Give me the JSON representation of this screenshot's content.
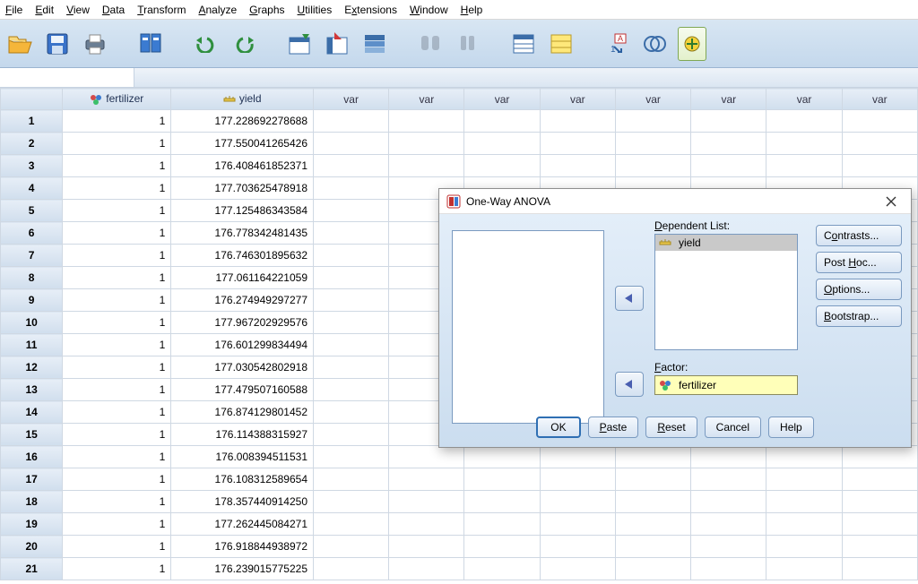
{
  "menu": [
    "File",
    "Edit",
    "View",
    "Data",
    "Transform",
    "Analyze",
    "Graphs",
    "Utilities",
    "Extensions",
    "Window",
    "Help"
  ],
  "columns": {
    "var1": "fertilizer",
    "var2": "yield",
    "blank": "var"
  },
  "rows": [
    {
      "n": "1",
      "f": "1",
      "y": "177.228692278688"
    },
    {
      "n": "2",
      "f": "1",
      "y": "177.550041265426"
    },
    {
      "n": "3",
      "f": "1",
      "y": "176.408461852371"
    },
    {
      "n": "4",
      "f": "1",
      "y": "177.703625478918"
    },
    {
      "n": "5",
      "f": "1",
      "y": "177.125486343584"
    },
    {
      "n": "6",
      "f": "1",
      "y": "176.778342481435"
    },
    {
      "n": "7",
      "f": "1",
      "y": "176.746301895632"
    },
    {
      "n": "8",
      "f": "1",
      "y": "177.061164221059"
    },
    {
      "n": "9",
      "f": "1",
      "y": "176.274949297277"
    },
    {
      "n": "10",
      "f": "1",
      "y": "177.967202929576"
    },
    {
      "n": "11",
      "f": "1",
      "y": "176.601299834494"
    },
    {
      "n": "12",
      "f": "1",
      "y": "177.030542802918"
    },
    {
      "n": "13",
      "f": "1",
      "y": "177.479507160588"
    },
    {
      "n": "14",
      "f": "1",
      "y": "176.874129801452"
    },
    {
      "n": "15",
      "f": "1",
      "y": "176.114388315927"
    },
    {
      "n": "16",
      "f": "1",
      "y": "176.008394511531"
    },
    {
      "n": "17",
      "f": "1",
      "y": "176.108312589654"
    },
    {
      "n": "18",
      "f": "1",
      "y": "178.357440914250"
    },
    {
      "n": "19",
      "f": "1",
      "y": "177.262445084271"
    },
    {
      "n": "20",
      "f": "1",
      "y": "176.918844938972"
    },
    {
      "n": "21",
      "f": "1",
      "y": "176.239015775225"
    }
  ],
  "dialog": {
    "title": "One-Way ANOVA",
    "dep_label": "Dependent List:",
    "dep_item": "yield",
    "fac_label": "Factor:",
    "fac_item": "fertilizer",
    "side": {
      "contrasts": "Contrasts...",
      "posthoc": "Post Hoc...",
      "options": "Options...",
      "bootstrap": "Bootstrap..."
    },
    "footer": {
      "ok": "OK",
      "paste": "Paste",
      "reset": "Reset",
      "cancel": "Cancel",
      "help": "Help"
    }
  }
}
